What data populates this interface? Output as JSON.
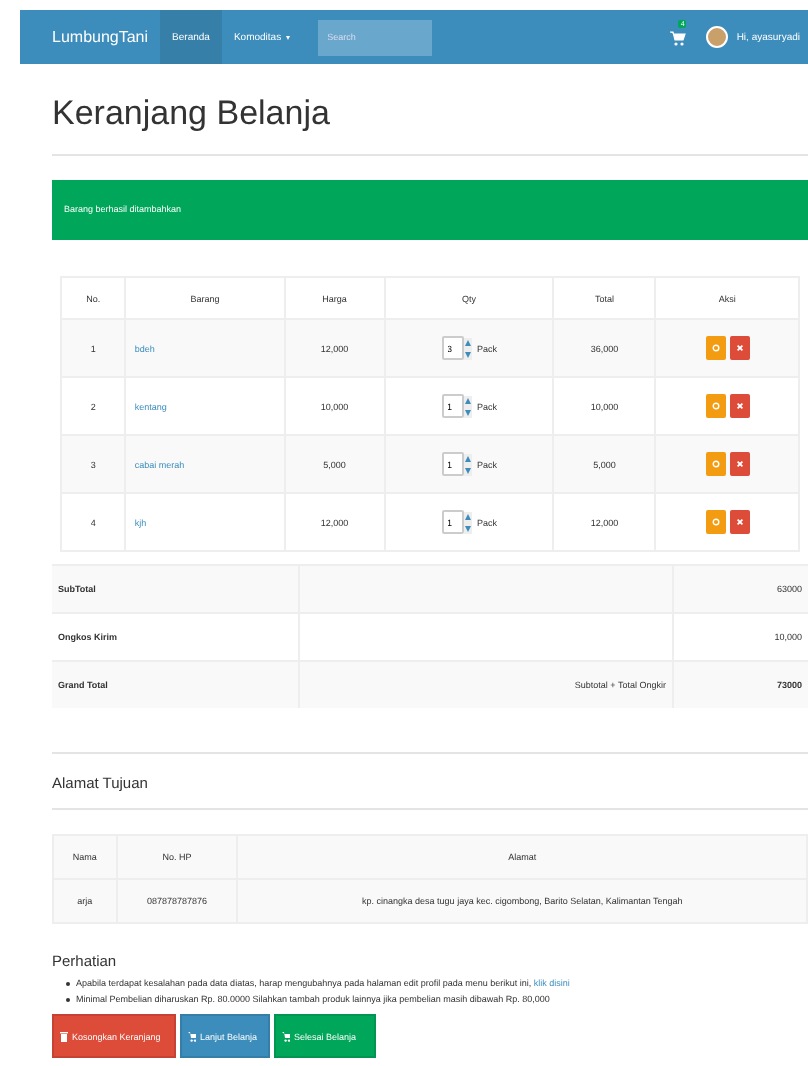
{
  "navbar": {
    "brand": "LumbungTani",
    "menu": [
      {
        "label": "Beranda",
        "selected": true,
        "dropdown": false
      },
      {
        "label": "Komoditas",
        "selected": false,
        "dropdown": true
      }
    ],
    "search": {
      "placeholder": "Search"
    },
    "cart_count": "4",
    "user": "Hi, ayasuryadi"
  },
  "title": "Keranjang Belanja",
  "alert": "Barang berhasil ditambahkan",
  "cart": {
    "columns": [
      "No.",
      "Barang",
      "Harga",
      "Qty",
      "Total",
      "Aksi"
    ],
    "rows": [
      {
        "no": "1",
        "item": "bdeh",
        "price": "12,000",
        "qty": "3",
        "unit": "Pack",
        "total": "36,000"
      },
      {
        "no": "2",
        "item": "kentang",
        "price": "10,000",
        "qty": "1",
        "unit": "Pack",
        "total": "10,000"
      },
      {
        "no": "3",
        "item": "cabai merah",
        "price": "5,000",
        "qty": "1",
        "unit": "Pack",
        "total": "5,000"
      },
      {
        "no": "4",
        "item": "kjh",
        "price": "12,000",
        "qty": "1",
        "unit": "Pack",
        "total": "12,000"
      }
    ]
  },
  "summary": [
    {
      "label": "SubTotal",
      "value": "63000",
      "bold": false
    },
    {
      "label": "Ongkos Kirim",
      "value": "10,000",
      "bold": false
    },
    {
      "label": "Grand Total",
      "note": "Subtotal + Total Ongkir",
      "value": "73000",
      "bold": true
    }
  ],
  "address": {
    "heading": "Alamat Tujuan",
    "columns": [
      "Nama",
      "No. HP",
      "Alamat"
    ],
    "row": [
      "arja",
      "087878787876",
      "kp. cinangka desa tugu jaya kec. cigombong, Barito Selatan, Kalimantan Tengah"
    ]
  },
  "notice": {
    "heading": "Perhatian",
    "items": [
      {
        "text": "Apabila terdapat kesalahan pada data diatas, harap mengubahnya pada halaman edit profil pada menu berikut ini, ",
        "link": "klik disini"
      },
      {
        "text": "Minimal Pembelian diharuskan Rp. 80.0000 Silahkan tambah produk lainnya jika pembelian masih dibawah Rp. 80,000"
      }
    ]
  },
  "buttons": [
    {
      "label": "Kosongkan Keranjang",
      "kind": "danger"
    },
    {
      "label": "Lanjut Belanja",
      "kind": "primary"
    },
    {
      "label": "Selesai Belanja",
      "kind": "success"
    }
  ]
}
